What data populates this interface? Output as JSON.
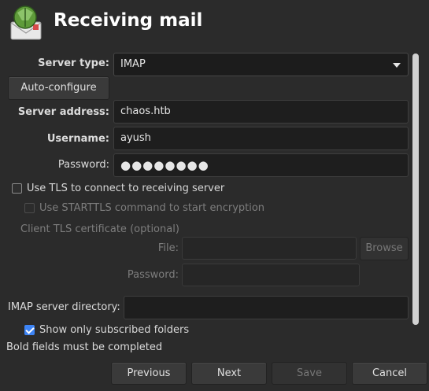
{
  "header": {
    "title": "Receiving mail",
    "logo_icon": "mail-app-logo-icon"
  },
  "form": {
    "server_type_label": "Server type:",
    "server_type_value": "IMAP",
    "autoconfig_label": "Auto-configure",
    "server_address_label": "Server address:",
    "server_address_value": "chaos.htb",
    "username_label": "Username:",
    "username_value": "ayush",
    "password_label": "Password:",
    "password_value": "●●●●●●●●",
    "use_tls_label": "Use TLS to connect to receiving server",
    "use_tls_checked": false,
    "starttls_label": "Use STARTTLS command to start encryption",
    "starttls_checked": false,
    "client_cert_label": "Client TLS certificate (optional)",
    "file_label": "File:",
    "file_value": "",
    "browse_label": "Browse",
    "cert_password_label": "Password:",
    "cert_password_value": "",
    "imap_dir_label": "IMAP server directory:",
    "imap_dir_value": "",
    "subscribed_label": "Show only subscribed folders",
    "subscribed_checked": true
  },
  "footer": {
    "hint": "Bold fields must be completed",
    "previous_label": "Previous",
    "next_label": "Next",
    "save_label": "Save",
    "cancel_label": "Cancel"
  },
  "colors": {
    "background": "#2b2b2b",
    "field": "#1e1e1e",
    "accent": "#3d84f5",
    "title": "#ffffff"
  }
}
